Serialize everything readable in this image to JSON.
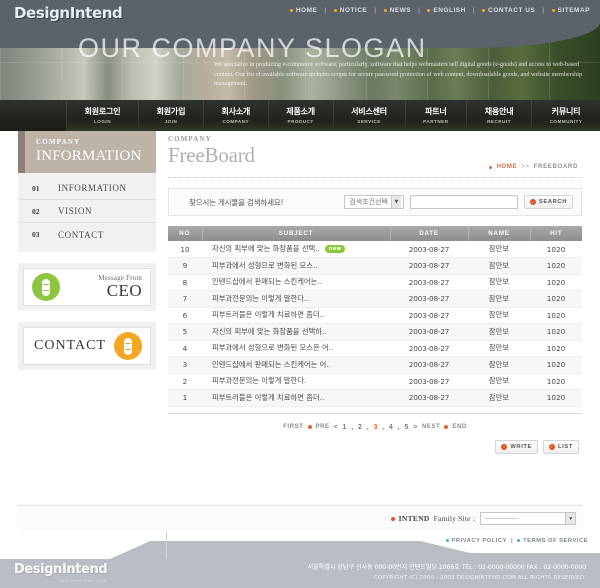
{
  "colors": {
    "top_bar": "#5b626a",
    "accent_orange": "#e2521e",
    "accent_green": "#8cc63f",
    "nav_dark": "#23261f",
    "sidebar_head": "#bdb3a7",
    "footer_gray": "#b9bec4",
    "link_blue": "#4aa3d6"
  },
  "logo": {
    "main": "DesignIntend",
    "sub": "DESIGNINTEND.COM"
  },
  "topnav": {
    "items": [
      {
        "label": "HOME"
      },
      {
        "label": "NOTICE"
      },
      {
        "label": "NEWS"
      },
      {
        "label": "ENGLISH"
      },
      {
        "label": "CONTACT US"
      },
      {
        "label": "SITEMAP"
      }
    ],
    "separator": "|"
  },
  "banner": {
    "slogan": "OUR COMPANY SLOGAN",
    "paragraph": "We specialize in producing e-commerce software, particularly, software that helps webmasters sell digital goods (e-goods) and access to web-based content. Our list of available software includes scripts for secure password protection of web content, downloadable goods, and website membership management."
  },
  "mainnav": {
    "items": [
      {
        "ko": "회원로그인",
        "en": "LOGIN"
      },
      {
        "ko": "회원가입",
        "en": "JOIN"
      },
      {
        "ko": "회사소개",
        "en": "COMPANY"
      },
      {
        "ko": "제품소개",
        "en": "PRODUCT"
      },
      {
        "ko": "서비스센터",
        "en": "SERVICE"
      },
      {
        "ko": "파트너",
        "en": "PARTNER"
      },
      {
        "ko": "채용안내",
        "en": "RECRUIT"
      },
      {
        "ko": "커뮤니티",
        "en": "COMMUNITY"
      }
    ]
  },
  "sidebar": {
    "head_top": "COMPANY",
    "head_main": "INFORMATION",
    "items": [
      {
        "num": "01",
        "label": "INFORMATION"
      },
      {
        "num": "02",
        "label": "VISION"
      },
      {
        "num": "03",
        "label": "CONTACT"
      }
    ],
    "banners": [
      {
        "small": "Message From",
        "big": "CEO",
        "icon": "capsule-icon",
        "color": "#8cc63f"
      },
      {
        "text": "CONTACT",
        "icon": "capsule-icon",
        "color": "#f5a623"
      }
    ]
  },
  "content": {
    "head_top": "COMPANY",
    "head_main": "FreeBoard",
    "breadcrumb": {
      "home": "HOME",
      "sep": ">>",
      "current": "FREEBOARD"
    },
    "search": {
      "label": "찾으시는 게시물을 검색하세요!",
      "select_value": "검색조건선택",
      "input_value": "",
      "input_placeholder": "",
      "button_label": "SEARCH"
    },
    "table": {
      "columns": [
        "NO",
        "SUBJECT",
        "DATE",
        "NAME",
        "HIT"
      ],
      "rows": [
        {
          "no": "10",
          "subject": "자신의 피부에 맞는 화장품을 선택..",
          "badge": "new",
          "date": "2003-08-27",
          "name": "잠만보",
          "hit": "1020"
        },
        {
          "no": "9",
          "subject": "피부과에서 성형으로 변화된 모스..",
          "badge": "",
          "date": "2003-08-27",
          "name": "잠만보",
          "hit": "1020"
        },
        {
          "no": "8",
          "subject": "인텐드샵에서 판매되는 스킨케어는..",
          "badge": "",
          "date": "2003-08-27",
          "name": "잠만보",
          "hit": "1020"
        },
        {
          "no": "7",
          "subject": "피부과전문의는 이렇게 말한다..",
          "badge": "",
          "date": "2003-08-27",
          "name": "잠만보",
          "hit": "1020"
        },
        {
          "no": "6",
          "subject": "피부트러블은 이렇게 치료하면 좀더..",
          "badge": "",
          "date": "2003-08-27",
          "name": "잠만보",
          "hit": "1020"
        },
        {
          "no": "5",
          "subject": "자신의 피부에 맞는 화장품을 선택하..",
          "badge": "",
          "date": "2003-08-27",
          "name": "잠만보",
          "hit": "1020"
        },
        {
          "no": "4",
          "subject": "피부과에서 성형으로 변화된 모스은 어..",
          "badge": "",
          "date": "2003-08-27",
          "name": "잠만보",
          "hit": "1020"
        },
        {
          "no": "3",
          "subject": "인텐드샵에서 판매되는 스킨케어는 어..",
          "badge": "",
          "date": "2003-08-27",
          "name": "잠만보",
          "hit": "1020"
        },
        {
          "no": "2",
          "subject": "피부과전문의는 이렇게 말한다.",
          "badge": "",
          "date": "2003-08-27",
          "name": "잠만보",
          "hit": "1020"
        },
        {
          "no": "1",
          "subject": "피부트러블은 이렇게 치료하면 좀더..",
          "badge": "",
          "date": "2003-08-27",
          "name": "잠만보",
          "hit": "1020"
        }
      ]
    },
    "pager": {
      "first": "FIRST",
      "prev": "PRE",
      "open": "<",
      "pages": [
        "1",
        "2",
        "3",
        "4",
        "5"
      ],
      "current": "3",
      "close": ">",
      "next": "NEST",
      "end": "END"
    },
    "actions": [
      {
        "label": "WRITE"
      },
      {
        "label": "LIST"
      }
    ]
  },
  "family_site": {
    "brand": "INTEND",
    "label": "Family Site :",
    "select_value": "-------------------"
  },
  "footer": {
    "links": [
      {
        "label": "PRIVACY POLICY"
      },
      {
        "label": "TERMS OF SERVICE"
      }
    ],
    "separator": "|",
    "logo_main": "DesignIntend",
    "logo_sub": "DESIGNINTEND.COM",
    "address": "서울특별시 강남구 신사동 000-00번지 인텐드빌딩 1006호  TEL : 02-0000-00000  FAX : 02-0000-0000",
    "copyright": "COPYRIGHT (C) 2000 - 2003 DESIGNINTEND.COM  ALL RIGHTS RESERVED."
  }
}
